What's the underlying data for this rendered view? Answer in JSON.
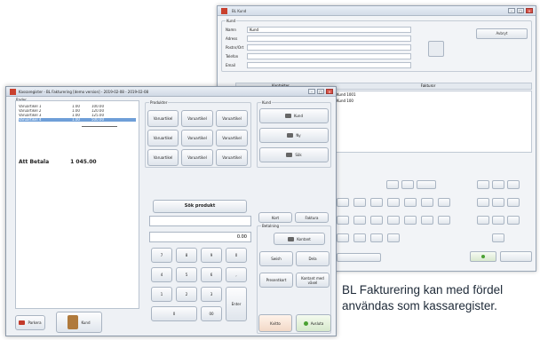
{
  "customer_window": {
    "title": "BL Kund",
    "group_label": "Kund",
    "fields": [
      {
        "label": "Namn",
        "value": "Kund"
      },
      {
        "label": "Adress",
        "value": ""
      },
      {
        "label": "Postnr/Ort",
        "value": ""
      },
      {
        "label": "Telefon",
        "value": ""
      },
      {
        "label": "Email",
        "value": ""
      }
    ],
    "delete_label": "Avbryt",
    "tabs": [
      "Kontakter",
      "Fakturor"
    ],
    "list_items": [
      "Kund 1001",
      "Kund 100"
    ]
  },
  "register_window": {
    "title": "Kassaregister - BL Fakturering [demo version] - 2019-02-08 - 2019-02-08",
    "rows_group_label": "Rader",
    "rows": [
      {
        "name": "Varuartikel 1",
        "qty": "1.00",
        "price": "100.00"
      },
      {
        "name": "Varuartikel 2",
        "qty": "1.00",
        "price": "120.00"
      },
      {
        "name": "Varuartikel 3",
        "qty": "1.00",
        "price": "125.00"
      },
      {
        "name": "Varuartikel 4",
        "qty": "1.00",
        "price": "500.00"
      }
    ],
    "total_label": "Att Betala",
    "total_value": "1 045.00",
    "products_group_label": "Produkter",
    "product_buttons": [
      "Varuartikel",
      "Varuartikel",
      "Varuartikel",
      "Varuartikel",
      "Varuartikel",
      "Varuartikel",
      "Varuartikel",
      "Varuartikel",
      "Varuartikel"
    ],
    "search_button": "Sök produkt",
    "amount_display": "0.00",
    "keypad": [
      "7",
      "8",
      "9",
      "0",
      "4",
      "5",
      "6",
      ",",
      "1",
      "2",
      "3",
      "0",
      "00"
    ],
    "enter_label": "Enter",
    "customer_group_label": "Kund",
    "customer_buttons": [
      "Kund",
      "Ny",
      "Sök"
    ],
    "payment_group_label": "Betalning",
    "payment_buttons": [
      "Kontant",
      "Kort",
      "Faktura",
      "Swish",
      "Presentkort",
      "Kontant med växel",
      "Dela"
    ],
    "bottom_buttons": [
      "Parkera",
      "Kvitto",
      "Avsluta"
    ]
  },
  "caption": {
    "line1": "BL Fakturering kan med fördel",
    "line2": "användas som kassaregister."
  }
}
